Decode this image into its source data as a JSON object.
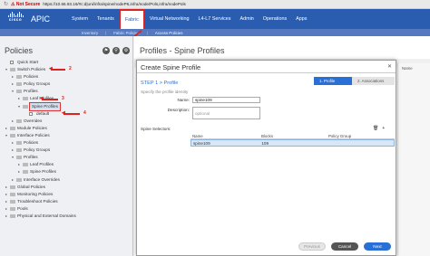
{
  "browser": {
    "warning": "Not Secure",
    "url": "https://10.66.93.16/#c:d|uni/infra/spine/nodeP6,infra/node/Pols,infra/nodePols"
  },
  "header": {
    "brand": "cisco",
    "app_title": "APIC",
    "tabs": [
      "System",
      "Tenants",
      "Fabric",
      "Virtual Networking",
      "L4-L7 Services",
      "Admin",
      "Operations",
      "Apps"
    ],
    "active_tab": "Fabric",
    "subtabs": [
      "Inventory",
      "Fabric Policies",
      "Access Policies"
    ],
    "active_subtab": "Access Policies"
  },
  "left_panel": {
    "title": "Policies",
    "tree": [
      {
        "label": "Quick Start",
        "indent": 0,
        "arrow": "",
        "icon": "leaf"
      },
      {
        "label": "Switch Policies",
        "indent": 0,
        "arrow": "down",
        "icon": "folder"
      },
      {
        "label": "Policies",
        "indent": 1,
        "arrow": "right",
        "icon": "folder"
      },
      {
        "label": "Policy Groups",
        "indent": 1,
        "arrow": "right",
        "icon": "folder"
      },
      {
        "label": "Profiles",
        "indent": 1,
        "arrow": "down",
        "icon": "folder"
      },
      {
        "label": "Leaf Profiles",
        "indent": 2,
        "arrow": "right",
        "icon": "folder"
      },
      {
        "label": "Spine Profiles",
        "indent": 2,
        "arrow": "down",
        "icon": "folder",
        "selected": true
      },
      {
        "label": "default",
        "indent": 3,
        "arrow": "",
        "icon": "leaf"
      },
      {
        "label": "Overrides",
        "indent": 1,
        "arrow": "right",
        "icon": "folder"
      },
      {
        "label": "Module Policies",
        "indent": 0,
        "arrow": "right",
        "icon": "folder"
      },
      {
        "label": "Interface Policies",
        "indent": 0,
        "arrow": "down",
        "icon": "folder"
      },
      {
        "label": "Policies",
        "indent": 1,
        "arrow": "right",
        "icon": "folder"
      },
      {
        "label": "Policy Groups",
        "indent": 1,
        "arrow": "right",
        "icon": "folder"
      },
      {
        "label": "Profiles",
        "indent": 1,
        "arrow": "down",
        "icon": "folder"
      },
      {
        "label": "Leaf Profiles",
        "indent": 2,
        "arrow": "right",
        "icon": "folder"
      },
      {
        "label": "Spine Profiles",
        "indent": 2,
        "arrow": "right",
        "icon": "folder"
      },
      {
        "label": "Interface Overrides",
        "indent": 1,
        "arrow": "right",
        "icon": "folder"
      },
      {
        "label": "Global Policies",
        "indent": 0,
        "arrow": "right",
        "icon": "folder"
      },
      {
        "label": "Monitoring Policies",
        "indent": 0,
        "arrow": "right",
        "icon": "folder"
      },
      {
        "label": "Troubleshoot Policies",
        "indent": 0,
        "arrow": "right",
        "icon": "folder"
      },
      {
        "label": "Pools",
        "indent": 0,
        "arrow": "right",
        "icon": "folder"
      },
      {
        "label": "Physical and External Domains",
        "indent": 0,
        "arrow": "right",
        "icon": "folder"
      }
    ],
    "annotations": [
      "2",
      "3",
      "4"
    ]
  },
  "main": {
    "title": "Profiles - Spine Profiles",
    "peek_text": "Name"
  },
  "dialog": {
    "title": "Create Spine Profile",
    "step_label": "STEP 1 > Profile",
    "step_subtitle": "Specify the profile identity",
    "steps": [
      "1. Profile",
      "2. Associations"
    ],
    "name_label": "Name:",
    "name_value": "spine109",
    "description_label": "Description:",
    "description_placeholder": "optional",
    "selectors_label": "Spine Selectors:",
    "columns": [
      "Name",
      "Blocks",
      "Policy Group"
    ],
    "rows": [
      {
        "name": "spine109",
        "blocks": "109",
        "policy_group": ""
      }
    ],
    "buttons": {
      "previous": "Previous",
      "cancel": "Cancel",
      "next": "Next"
    }
  },
  "colors": {
    "primary": "#2a5db0",
    "accent": "#2a6fd6",
    "annotation": "#d22222"
  }
}
